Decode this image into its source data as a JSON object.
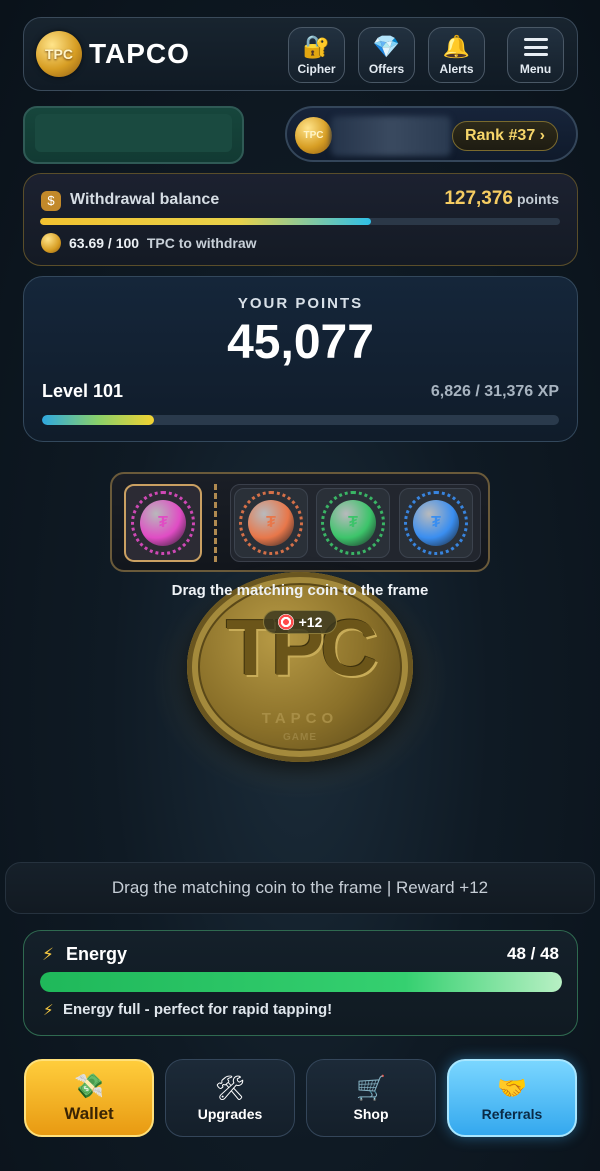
{
  "header": {
    "logo_text": "TPC",
    "brand": "TAPCO",
    "buttons": [
      {
        "label": "Cipher",
        "icon": "lock-key-icon"
      },
      {
        "label": "Offers",
        "icon": "diamond-icon"
      },
      {
        "label": "Alerts",
        "icon": "bell-icon"
      },
      {
        "label": "Menu",
        "icon": "hamburger-icon"
      }
    ]
  },
  "profile": {
    "coin_text": "TPC",
    "rank": "Rank #37 ›"
  },
  "withdrawal": {
    "title": "Withdrawal balance",
    "value": "127,376",
    "unit": "points",
    "progress": 0.6369,
    "amount": "63.69 / 100",
    "suffix": "TPC to withdraw"
  },
  "points": {
    "title": "YOUR POINTS",
    "value": "45,077",
    "level": "Level 101",
    "xp": "6,826 / 31,376 XP",
    "xp_progress": 0.2175
  },
  "puzzle": {
    "coins": [
      {
        "name": "pink",
        "color": "#e04cc4"
      },
      {
        "name": "orange",
        "color": "#e8774a"
      },
      {
        "name": "green",
        "color": "#3cc46a"
      },
      {
        "name": "blue",
        "color": "#3a8ef0"
      }
    ],
    "hint": "Drag the matching coin to the frame",
    "reward": "+12"
  },
  "big_coin": {
    "main": "TPC",
    "ring": "TAPCO",
    "sub": "GAME"
  },
  "status": {
    "text": "Drag the matching coin to the frame | Reward +12"
  },
  "energy": {
    "title": "Energy",
    "value": "48 / 48",
    "progress": 1.0,
    "message": "Energy full - perfect for rapid tapping!"
  },
  "nav": [
    {
      "label": "Wallet",
      "icon": "money-icon"
    },
    {
      "label": "Upgrades",
      "icon": "tools-icon"
    },
    {
      "label": "Shop",
      "icon": "cart-icon"
    },
    {
      "label": "Referrals",
      "icon": "handshake-icon"
    }
  ],
  "colors": {
    "gold": "#f5cc62",
    "energy_green": "#35d070",
    "wallet_orange": "#e89a12",
    "referrals_blue": "#34a8ee"
  }
}
